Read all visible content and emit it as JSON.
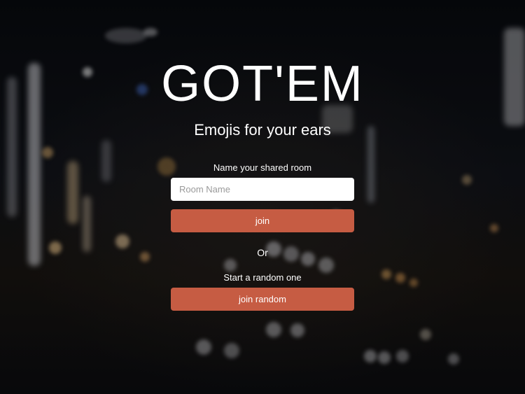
{
  "brand": {
    "logo": "GOT'EM",
    "tagline": "Emojis for your ears"
  },
  "join_form": {
    "label": "Name your shared room",
    "room_input_placeholder": "Room Name",
    "room_input_value": "",
    "join_button_label": "join"
  },
  "divider_text": "Or",
  "random_form": {
    "label": "Start a random one",
    "join_random_button_label": "join random"
  },
  "colors": {
    "button": "#c65c43",
    "text": "#ffffff",
    "input_bg": "#ffffff",
    "background": "#0b0d12"
  }
}
